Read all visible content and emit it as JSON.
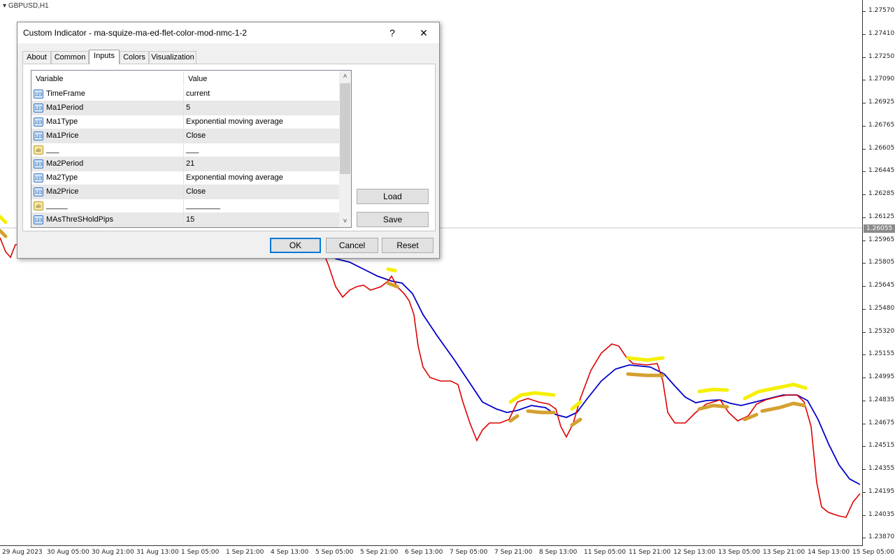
{
  "chart": {
    "symbol": "GBPUSD,H1",
    "price_labels": [
      "1.27570",
      "1.27410",
      "1.27250",
      "1.27090",
      "1.26925",
      "1.26765",
      "1.26605",
      "1.26445",
      "1.26285",
      "1.26125",
      "1.25965",
      "1.25805",
      "1.25645",
      "1.25480",
      "1.25320",
      "1.25155",
      "1.24995",
      "1.24835",
      "1.24675",
      "1.24515",
      "1.24355",
      "1.24195",
      "1.24035",
      "1.23870"
    ],
    "current_price": "1.26055",
    "time_labels": [
      "29 Aug 2023",
      "30 Aug 05:00",
      "30 Aug 21:00",
      "31 Aug 13:00",
      "1 Sep 05:00",
      "1 Sep 21:00",
      "4 Sep 13:00",
      "5 Sep 05:00",
      "5 Sep 21:00",
      "6 Sep 13:00",
      "7 Sep 05:00",
      "7 Sep 21:00",
      "8 Sep 13:00",
      "11 Sep 05:00",
      "11 Sep 21:00",
      "12 Sep 13:00",
      "13 Sep 05:00",
      "13 Sep 21:00",
      "14 Sep 13:00",
      "15 Sep 05:00"
    ],
    "colors": {
      "fast_ma": "#dd0000",
      "slow_ma": "#0000cc",
      "flat_upper": "#f5f000",
      "flat_lower": "#d4a030",
      "candles": "#a0a0a0"
    }
  },
  "dialog": {
    "title": "Custom Indicator - ma-squize-ma-ed-flet-color-mod-nmc-1-2",
    "help_label": "?",
    "close_label": "✕",
    "tabs": [
      "About",
      "Common",
      "Inputs",
      "Colors",
      "Visualization"
    ],
    "active_tab": "Inputs",
    "grid": {
      "col_variable": "Variable",
      "col_value": "Value",
      "rows": [
        {
          "icon": "123",
          "name": "TimeFrame",
          "value": "current"
        },
        {
          "icon": "123",
          "name": "Ma1Period",
          "value": "5"
        },
        {
          "icon": "123",
          "name": "Ma1Type",
          "value": "Exponential moving average"
        },
        {
          "icon": "123",
          "name": "Ma1Price",
          "value": "Close"
        },
        {
          "icon": "ab",
          "name": "___",
          "value": "___"
        },
        {
          "icon": "123",
          "name": "Ma2Period",
          "value": "21"
        },
        {
          "icon": "123",
          "name": "Ma2Type",
          "value": "Exponential moving average"
        },
        {
          "icon": "123",
          "name": "Ma2Price",
          "value": "Close"
        },
        {
          "icon": "ab",
          "name": "_____",
          "value": "________"
        },
        {
          "icon": "123",
          "name": "MAsThreSHoldPips",
          "value": "15"
        }
      ]
    },
    "load_label": "Load",
    "save_label": "Save",
    "ok_label": "OK",
    "cancel_label": "Cancel",
    "reset_label": "Reset"
  }
}
